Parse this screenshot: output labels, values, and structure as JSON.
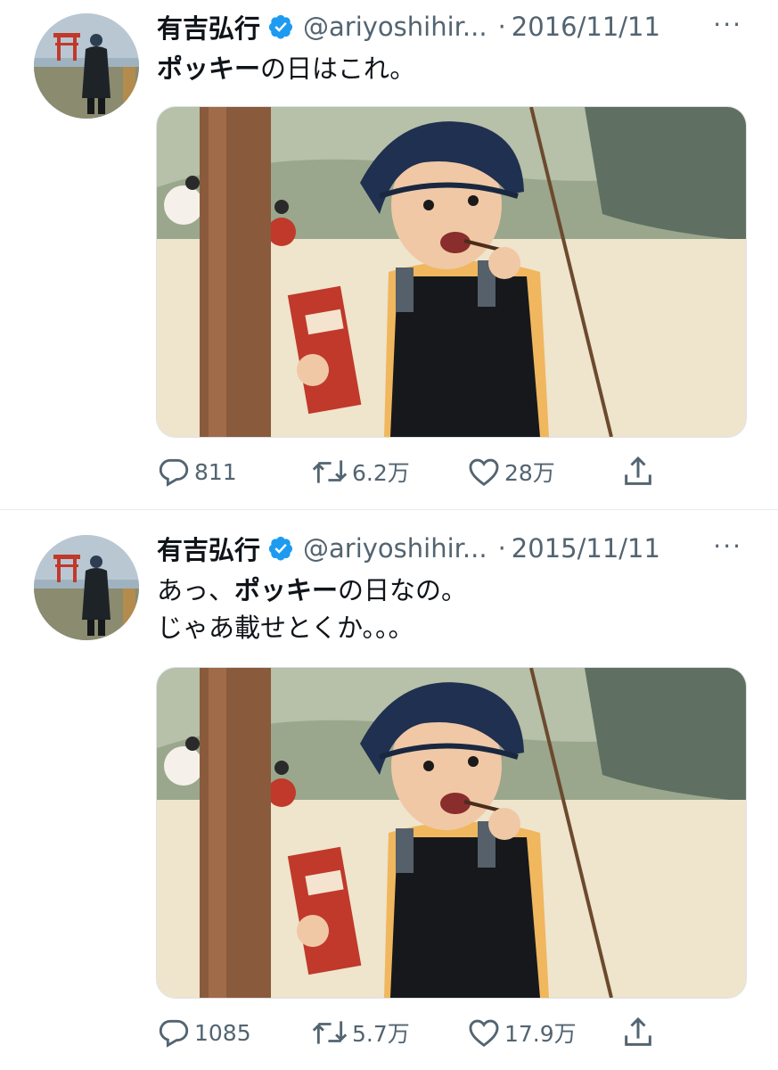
{
  "tweets": [
    {
      "name": "有吉弘行",
      "handle": "@ariyoshihir...",
      "dot": "·",
      "date": "2016/11/11",
      "text_bold": "ポッキー",
      "text_rest": "の日はこれ。",
      "replies": "811",
      "retweets": "6.2万",
      "likes": "28万"
    },
    {
      "name": "有吉弘行",
      "handle": "@ariyoshihir...",
      "dot": "·",
      "date": "2015/11/11",
      "text_pre": "あっ、",
      "text_bold": "ポッキー",
      "text_rest": "の日なの。",
      "text_line2": "じゃあ載せとくか。。。",
      "replies": "1085",
      "retweets": "5.7万",
      "likes": "17.9万"
    }
  ],
  "more_label": "···",
  "colors": {
    "verified": "#1d9bf0",
    "muted": "#536471",
    "text": "#0f1419"
  },
  "icons": [
    "verified-badge-icon",
    "reply-icon",
    "retweet-icon",
    "like-icon",
    "share-icon",
    "more-icon"
  ]
}
